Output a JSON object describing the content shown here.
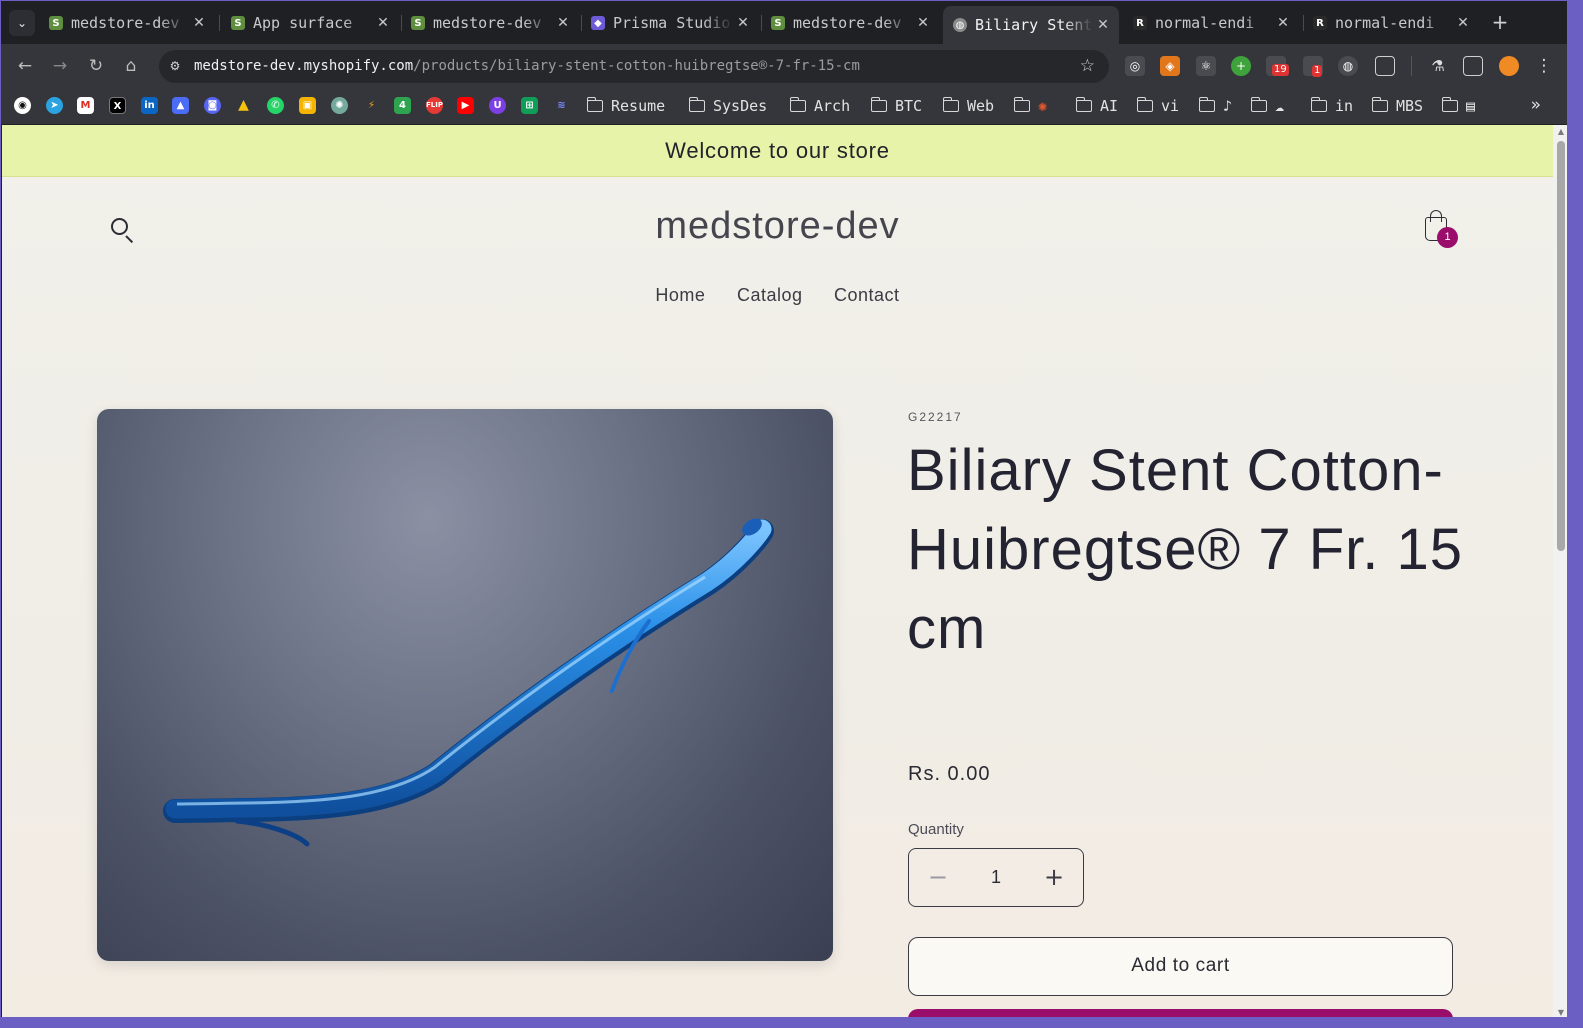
{
  "browser": {
    "tabs": [
      {
        "title": "medstore-dev",
        "favicon": "shopify-icon",
        "color": "#5e8e3e"
      },
      {
        "title": "App surface",
        "favicon": "shopify-icon",
        "color": "#5e8e3e"
      },
      {
        "title": "medstore-dev",
        "favicon": "shopify-icon",
        "color": "#5e8e3e"
      },
      {
        "title": "Prisma Studio",
        "favicon": "prisma-icon",
        "color": "#6c5bd6"
      },
      {
        "title": "medstore-dev",
        "favicon": "shopify-icon",
        "color": "#5e8e3e"
      },
      {
        "title": "Biliary Stent",
        "favicon": "globe-icon",
        "color": "#7a7a7a",
        "active": true
      },
      {
        "title": "normal-endi",
        "favicon": "r-icon",
        "color": "#222222"
      },
      {
        "title": "normal-endi",
        "favicon": "r-icon",
        "color": "#222222"
      }
    ],
    "url_host": "medstore-dev.myshopify.com",
    "url_path": "/products/biliary-stent-cotton-huibregtse®-7-fr-15-cm",
    "bookmarks": {
      "folders": [
        "Resume",
        "SysDes",
        "Arch",
        "BTC",
        "Web",
        "",
        "AI",
        "vi",
        "♪",
        "",
        "in",
        "MBS",
        ""
      ]
    },
    "extension_badges": [
      "19",
      "1"
    ]
  },
  "store": {
    "announcement": "Welcome to our store",
    "name": "medstore-dev",
    "cart_count": "1",
    "nav": [
      "Home",
      "Catalog",
      "Contact"
    ]
  },
  "product": {
    "sku": "G22217",
    "title": "Biliary Stent Cotton-Huibregtse® 7 Fr. 15 cm",
    "price": "Rs. 0.00",
    "quantity_label": "Quantity",
    "quantity": "1",
    "add_to_cart": "Add to cart",
    "image": "blue-biliary-stent-image"
  },
  "colors": {
    "announcement_bg": "#e7f3a8",
    "accent": "#9a0d6a",
    "stent": "#1c7fd6"
  }
}
